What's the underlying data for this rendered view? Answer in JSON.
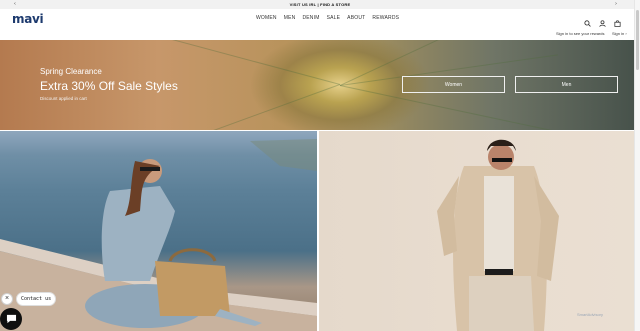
{
  "announcement": {
    "text": "VISIT US IRL | FIND A STORE",
    "prev": "‹",
    "next": "›"
  },
  "header": {
    "logo": "mavi",
    "nav": [
      "WOMEN",
      "MEN",
      "DENIM",
      "SALE",
      "ABOUT",
      "REWARDS"
    ],
    "rewards_link": "Sign in to see your rewards",
    "signin_link": "Sign in ›",
    "icons": [
      "search-icon",
      "account-icon",
      "bag-icon"
    ]
  },
  "hero": {
    "eyebrow": "Spring Clearance",
    "headline": "Extra 30% Off Sale Styles",
    "subtext": "Discount applied in cart",
    "buttons": {
      "women": "Women",
      "men": "Men"
    }
  },
  "chat": {
    "label": "Contact us",
    "close": "×"
  },
  "watermark": "SmartAdvisory",
  "colors": {
    "logo": "#1d3a6e",
    "chat_button": "#0f0f0f"
  }
}
